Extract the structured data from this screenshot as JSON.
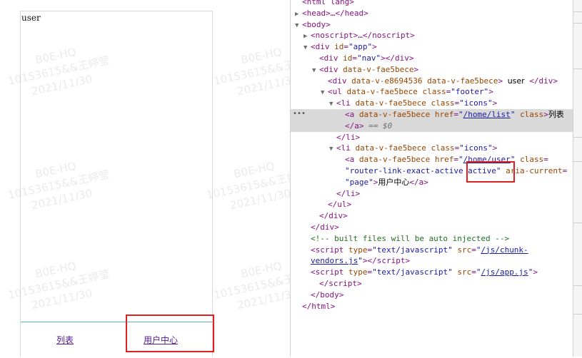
{
  "preview": {
    "page_text": "user",
    "footer": {
      "tab_list": "列表",
      "tab_user_center": "用户中心"
    },
    "watermark": "B0E-HQ\n10153615&&王婷莹\n2021/11/30"
  },
  "devtools": {
    "lines": [
      {
        "indent": 0,
        "tri": "",
        "html": "<span class='tag'>&lt;html lang&gt;</span>"
      },
      {
        "indent": 0,
        "tri": "▶",
        "html": "<span class='tag'>&lt;head&gt;</span>…<span class='tag'>&lt;/head&gt;</span>"
      },
      {
        "indent": 0,
        "tri": "▼",
        "html": "<span class='tag'>&lt;body&gt;</span>"
      },
      {
        "indent": 1,
        "tri": "▶",
        "html": "<span class='tag'>&lt;noscript&gt;</span>…<span class='tag'>&lt;/noscript&gt;</span>"
      },
      {
        "indent": 1,
        "tri": "▼",
        "html": "<span class='tag'>&lt;div </span><span class='attr'>id</span>=<span class='val'>\"app\"</span><span class='tag'>&gt;</span>"
      },
      {
        "indent": 2,
        "tri": "",
        "html": "<span class='tag'>&lt;div </span><span class='attr'>id</span>=<span class='val'>\"nav\"</span><span class='tag'>&gt;&lt;/div&gt;</span>"
      },
      {
        "indent": 2,
        "tri": "▼",
        "html": "<span class='tag'>&lt;div </span><span class='attr'>data-v-fae5bece</span><span class='tag'>&gt;</span>"
      },
      {
        "indent": 3,
        "tri": "",
        "html": "<span class='tag'>&lt;div </span><span class='attr'>data-v-e8694536 data-v-fae5bece</span><span class='tag'>&gt;</span> <span class='txt'>user</span> <span class='tag'>&lt;/div&gt;</span>"
      },
      {
        "indent": 3,
        "tri": "▼",
        "html": "<span class='tag'>&lt;ul </span><span class='attr'>data-v-fae5bece class</span>=<span class='val'>\"footer\"</span><span class='tag'>&gt;</span>"
      },
      {
        "indent": 4,
        "tri": "▼",
        "html": "<span class='tag'>&lt;li </span><span class='attr'>data-v-fae5bece class</span>=<span class='val'>\"icons\"</span><span class='tag'>&gt;</span>"
      },
      {
        "indent": 5,
        "tri": "",
        "selected": true,
        "html": "<span class='tag'>&lt;a </span><span class='attr'>data-v-fae5bece href</span>=<span class='val'>\"</span><span class='link'>/home/list</span><span class='val'>\"</span> <span class='attr'>class</span><span class='tag'>&gt;</span><span class='txt'>列表</span>"
      },
      {
        "indent": 5,
        "tri": "",
        "selected": true,
        "html": "<span class='tag'>&lt;/a&gt;</span> <span class='dim'>== $0</span>"
      },
      {
        "indent": 4,
        "tri": "",
        "html": "<span class='tag'>&lt;/li&gt;</span>"
      },
      {
        "indent": 4,
        "tri": "▼",
        "html": "<span class='tag'>&lt;li </span><span class='attr'>data-v-fae5bece class</span>=<span class='val'>\"icons\"</span><span class='tag'>&gt;</span>"
      },
      {
        "indent": 5,
        "tri": "",
        "html": "<span class='tag'>&lt;a </span><span class='attr'>data-v-fae5bece href</span>=<span class='val'>\"</span><span class='link'>/home/user</span><span class='val'>\"</span> <span class='attr'>class</span>="
      },
      {
        "indent": 5,
        "tri": "",
        "html": "<span class='val'>\"router-link-exact-active active\"</span> <span class='attr'>aria-current</span>="
      },
      {
        "indent": 5,
        "tri": "",
        "html": "<span class='val'>\"page\"</span><span class='tag'>&gt;</span><span class='txt'>用户中心</span><span class='tag'>&lt;/a&gt;</span>"
      },
      {
        "indent": 4,
        "tri": "",
        "html": "<span class='tag'>&lt;/li&gt;</span>"
      },
      {
        "indent": 3,
        "tri": "",
        "html": "<span class='tag'>&lt;/ul&gt;</span>"
      },
      {
        "indent": 2,
        "tri": "",
        "html": "<span class='tag'>&lt;/div&gt;</span>"
      },
      {
        "indent": 1,
        "tri": "",
        "html": "<span class='tag'>&lt;/div&gt;</span>"
      },
      {
        "indent": 1,
        "tri": "",
        "html": "<span class='comment'>&lt;!-- built files will be auto injected --&gt;</span>"
      },
      {
        "indent": 1,
        "tri": "",
        "html": "<span class='tag'>&lt;script </span><span class='attr'>type</span>=<span class='val'>\"text/javascript\"</span> <span class='attr'>src</span>=<span class='val'>\"</span><span class='link'>/js/chunk-</span>"
      },
      {
        "indent": 1,
        "tri": "",
        "html": "<span class='link'>vendors.js</span><span class='val'>\"</span><span class='tag'>&gt;&lt;/script&gt;</span>"
      },
      {
        "indent": 1,
        "tri": "",
        "html": "<span class='tag'>&lt;script </span><span class='attr'>type</span>=<span class='val'>\"text/javascript\"</span> <span class='attr'>src</span>=<span class='val'>\"</span><span class='link'>/js/app.js</span><span class='val'>\"</span><span class='tag'>&gt;</span>"
      },
      {
        "indent": 2,
        "tri": "",
        "html": "<span class='tag'>&lt;/script&gt;</span>"
      },
      {
        "indent": 1,
        "tri": "",
        "html": "<span class='tag'>&lt;/body&gt;</span>"
      },
      {
        "indent": 0,
        "tri": "",
        "html": "<span class='tag'>&lt;/html&gt;</span>"
      }
    ]
  },
  "colors": {
    "highlight_red": "#e02020",
    "footer_border": "#5fb2c0",
    "link_visited": "#551a8b"
  }
}
